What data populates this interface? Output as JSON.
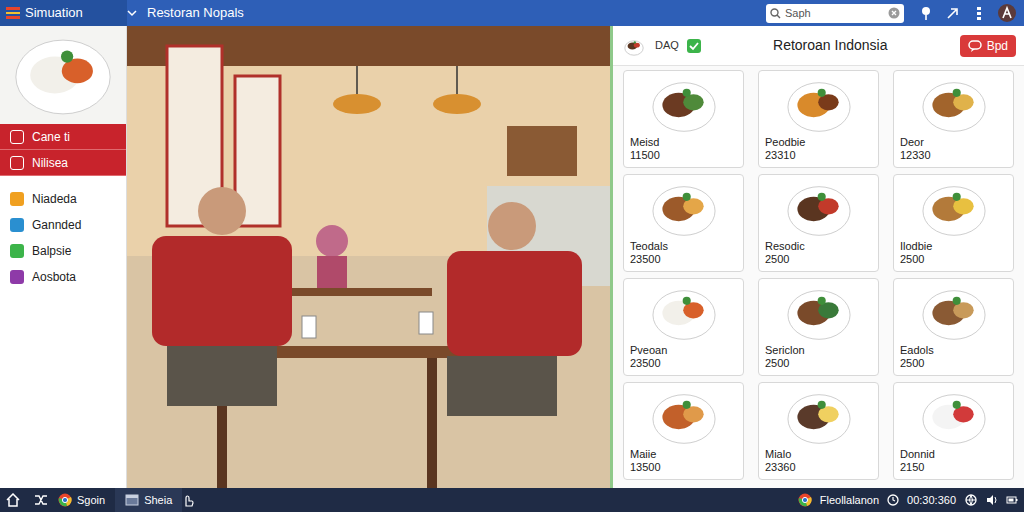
{
  "window": {
    "title": "Simuation",
    "subtitle": "Restoran Nopals"
  },
  "search": {
    "placeholder": "Saph"
  },
  "sidebar": {
    "items": [
      {
        "label": "Cane ti",
        "selected": true,
        "color": "#ffffff"
      },
      {
        "label": "Nilisea",
        "selected": true,
        "color": "#ffffff"
      },
      {
        "label": "Niadeda",
        "selected": false,
        "color": "#f0a020"
      },
      {
        "label": "Gannded",
        "selected": false,
        "color": "#2a8fd0"
      },
      {
        "label": "Balpsie",
        "selected": false,
        "color": "#3cb44a"
      },
      {
        "label": "Aosbota",
        "selected": false,
        "color": "#8e3aa8"
      }
    ]
  },
  "panel": {
    "badge": "DAQ",
    "title": "Retoroan Indonsia",
    "button": "Bpd"
  },
  "menu": [
    {
      "name": "Meisd",
      "price": "11500"
    },
    {
      "name": "Peodbie",
      "price": "23310"
    },
    {
      "name": "Deor",
      "price": "12330"
    },
    {
      "name": "Teodals",
      "price": "23500"
    },
    {
      "name": "Resodic",
      "price": "2500"
    },
    {
      "name": "Ilodbie",
      "price": "2500"
    },
    {
      "name": "Pveoan",
      "price": "23500"
    },
    {
      "name": "Sericlon",
      "price": "2500"
    },
    {
      "name": "Eadols",
      "price": "2500"
    },
    {
      "name": "Maiie",
      "price": "13500"
    },
    {
      "name": "Mialo",
      "price": "23360"
    },
    {
      "name": "Donnid",
      "price": "2150"
    }
  ],
  "taskbar": {
    "apps": [
      {
        "label": "Sgoin"
      },
      {
        "label": "Sheia"
      }
    ],
    "tray": {
      "app": "Fleollalanon",
      "clock": "00:30:360"
    }
  }
}
